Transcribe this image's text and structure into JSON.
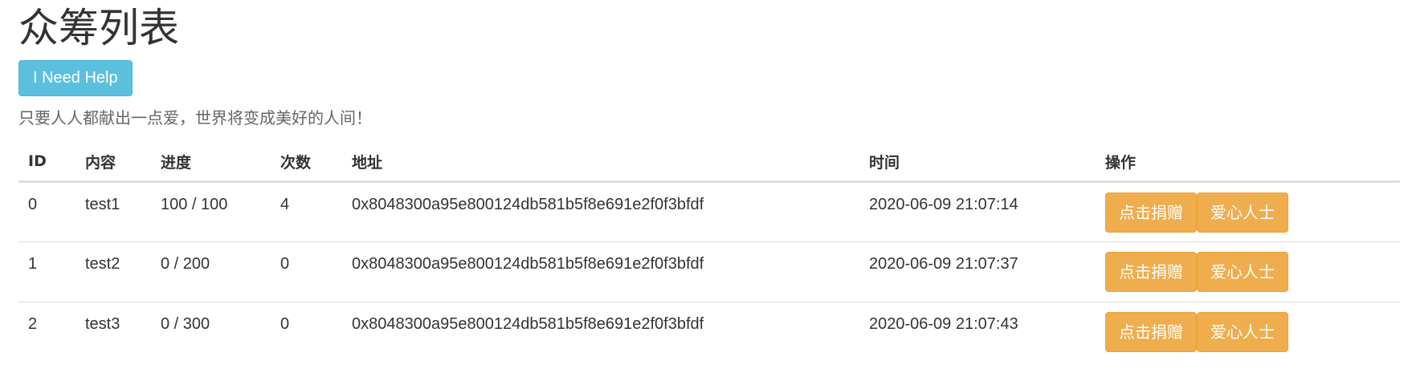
{
  "header": {
    "title": "众筹列表",
    "help_button_label": "I Need Help",
    "slogan": "只要人人都献出一点爱，世界将变成美好的人间！"
  },
  "table": {
    "columns": [
      "ID",
      "内容",
      "进度",
      "次数",
      "地址",
      "时间",
      "操作"
    ],
    "rows": [
      {
        "id": "0",
        "content": "test1",
        "progress": "100 / 100",
        "count": "4",
        "address": "0x8048300a95e800124db581b5f8e691e2f0f3bfdf",
        "time": "2020-06-09 21:07:14",
        "donate_label": "点击捐赠",
        "donors_label": "爱心人士"
      },
      {
        "id": "1",
        "content": "test2",
        "progress": "0 / 200",
        "count": "0",
        "address": "0x8048300a95e800124db581b5f8e691e2f0f3bfdf",
        "time": "2020-06-09 21:07:37",
        "donate_label": "点击捐赠",
        "donors_label": "爱心人士"
      },
      {
        "id": "2",
        "content": "test3",
        "progress": "0 / 300",
        "count": "0",
        "address": "0x8048300a95e800124db581b5f8e691e2f0f3bfdf",
        "time": "2020-06-09 21:07:43",
        "donate_label": "点击捐赠",
        "donors_label": "爱心人士"
      }
    ]
  },
  "colors": {
    "info_button": "#5bc0de",
    "warning_button": "#f0ad4e",
    "text": "#333333",
    "muted_text": "#666666",
    "border": "#dddddd"
  }
}
